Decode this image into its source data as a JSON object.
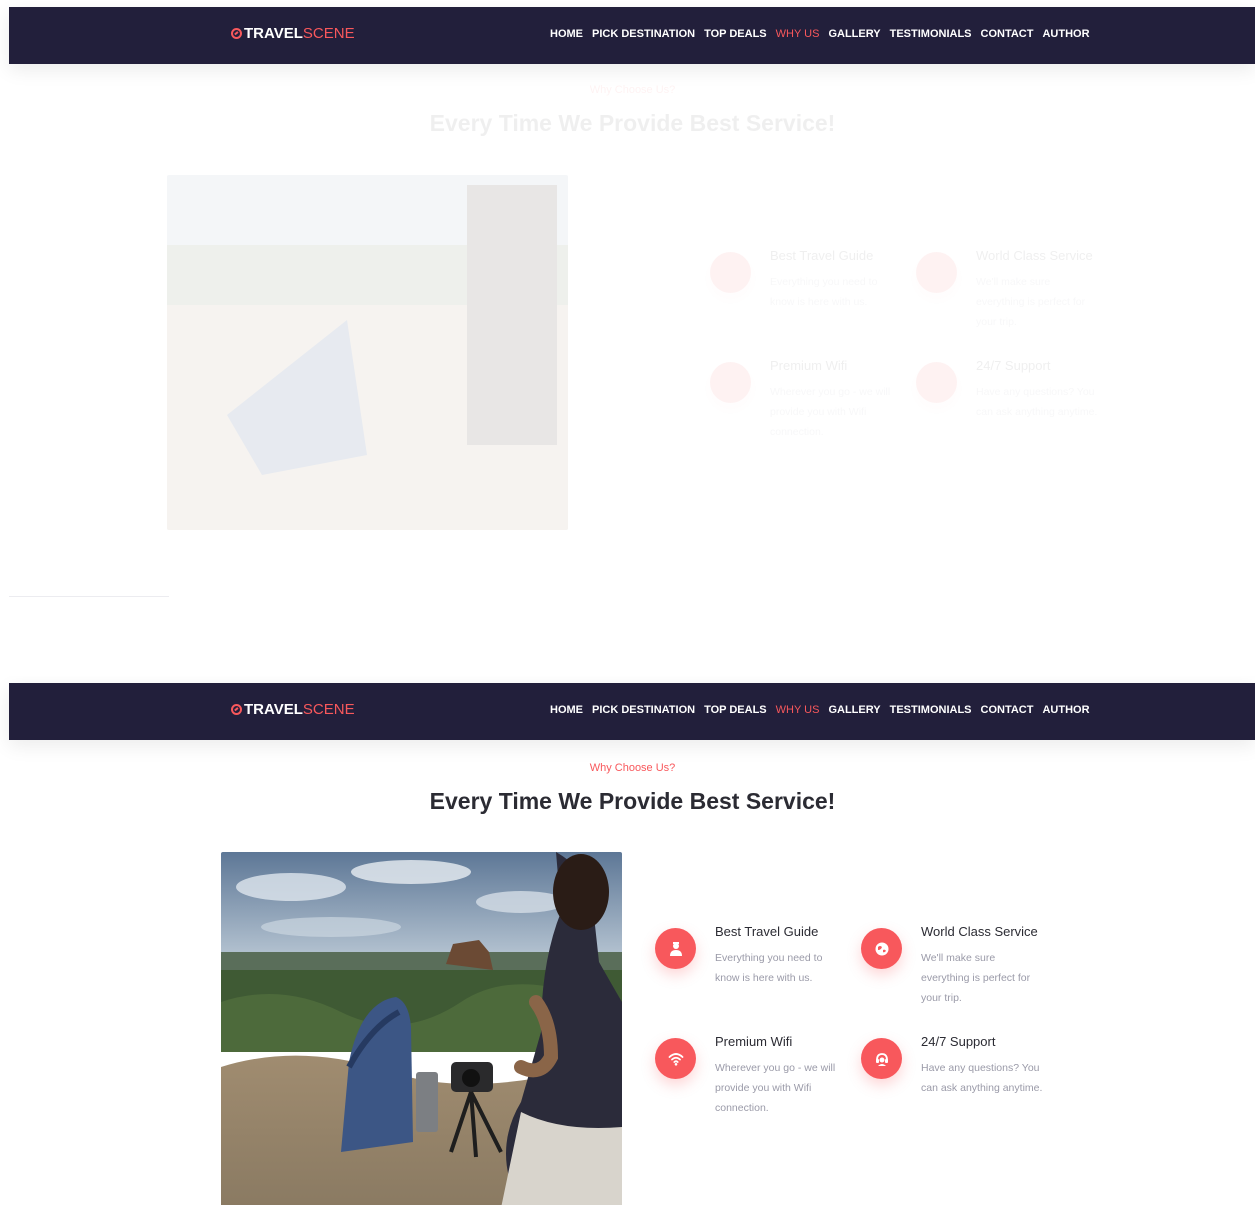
{
  "brand": {
    "name_part1": "TRAVEL",
    "name_part2": "SCENE"
  },
  "nav": {
    "items": [
      "HOME",
      "PICK DESTINATION",
      "TOP DEALS",
      "WHY US",
      "GALLERY",
      "TESTIMONIALS",
      "CONTACT",
      "AUTHOR"
    ],
    "active": "WHY US"
  },
  "section": {
    "subtitle": "Why Choose Us?",
    "title": "Every Time We Provide Best Service!"
  },
  "features": [
    {
      "icon": "tour-guide-icon",
      "title": "Best Travel Guide",
      "description": "Everything you need to know is here with us."
    },
    {
      "icon": "world-service-icon",
      "title": "World Class Service",
      "description": "We'll make sure everything is perfect for your trip."
    },
    {
      "icon": "wifi-icon",
      "title": "Premium Wifi",
      "description": "Wherever you go - we will provide you with Wifi connection."
    },
    {
      "icon": "support-icon",
      "title": "24/7 Support",
      "description": "Have any questions? You can ask anything anytime."
    }
  ],
  "colors": {
    "navbar": "#221f3b",
    "accent": "#f8585c",
    "heading": "#2b2b33",
    "muted": "#9a9aa8"
  }
}
